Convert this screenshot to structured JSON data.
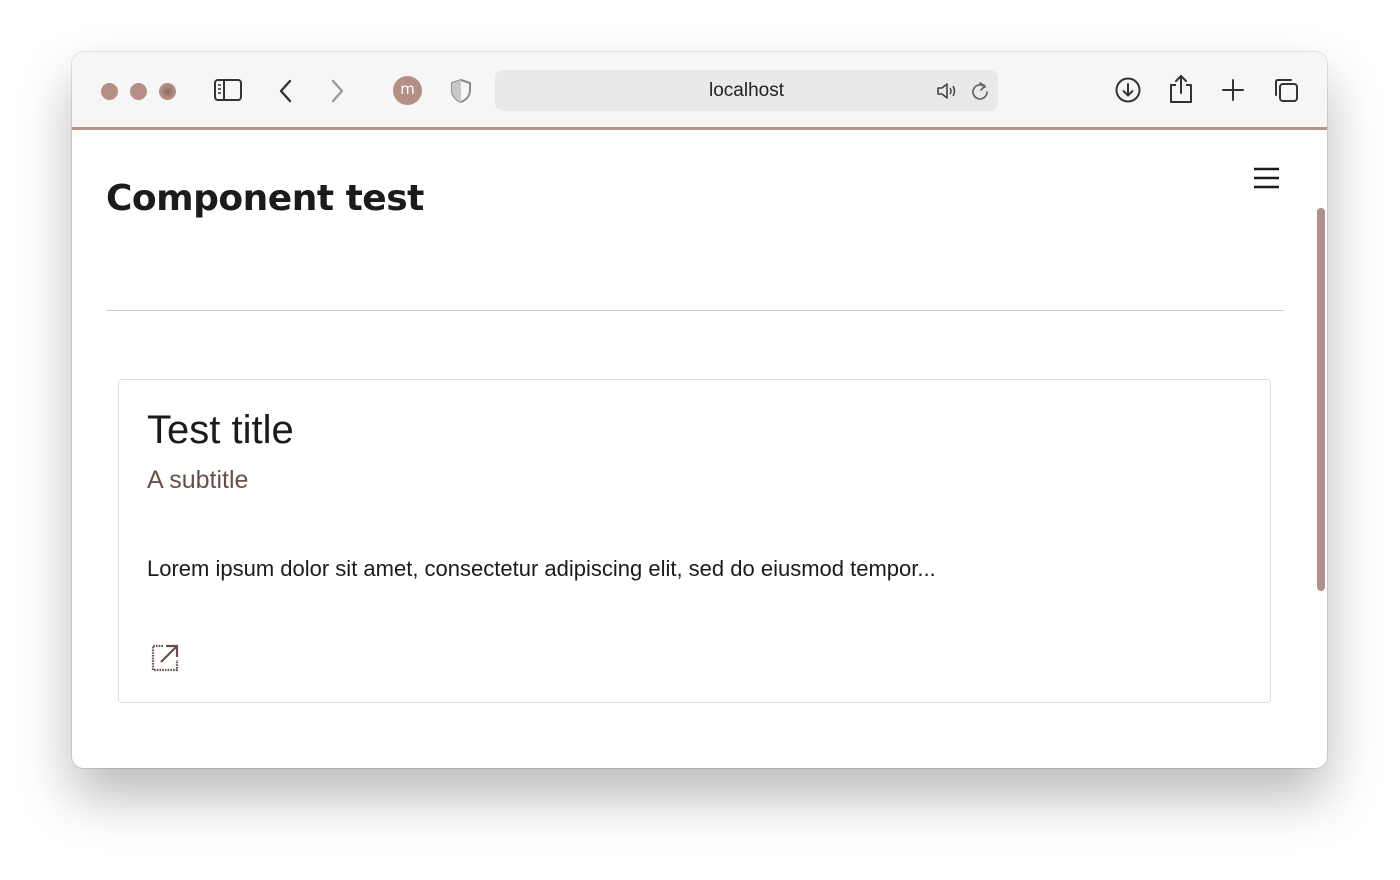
{
  "browser": {
    "url": "localhost",
    "profile_initial": "m",
    "accent_color": "#b58f86",
    "icons": {
      "sidebar": "sidebar-icon",
      "back": "back-chevron-icon",
      "forward": "forward-chevron-icon",
      "privacy": "shield-icon",
      "audio": "speaker-icon",
      "reload": "reload-icon",
      "downloads": "download-icon",
      "share": "share-icon",
      "new_tab": "plus-icon",
      "tabs": "tab-overview-icon"
    }
  },
  "page": {
    "title": "Component test",
    "menu_icon": "hamburger-menu-icon"
  },
  "card": {
    "title": "Test title",
    "subtitle": "A subtitle",
    "body": "Lorem ipsum dolor sit amet, consectetur adipiscing elit, sed do eiusmod tempor...",
    "link_icon": "external-link-icon"
  }
}
